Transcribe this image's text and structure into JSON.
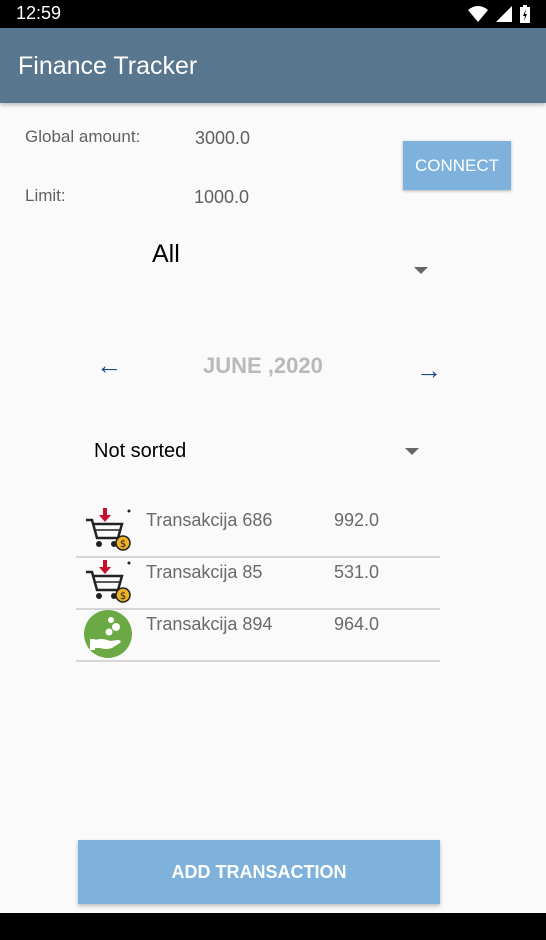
{
  "status": {
    "time": "12:59"
  },
  "app": {
    "title": "Finance Tracker"
  },
  "summary": {
    "global_label": "Global amount:",
    "global_value": "3000.0",
    "limit_label": "Limit:",
    "limit_value": "1000.0",
    "connect_label": "CONNECT"
  },
  "filter": {
    "selected": "All"
  },
  "month_nav": {
    "prev": "←",
    "label": "JUNE ,2020",
    "next": "→"
  },
  "sort": {
    "selected": "Not sorted"
  },
  "transactions": [
    {
      "name": "Transakcija 686",
      "amount": "992.0",
      "icon": "shopping-cart-icon"
    },
    {
      "name": "Transakcija 85",
      "amount": "531.0",
      "icon": "shopping-cart-icon"
    },
    {
      "name": "Transakcija 894",
      "amount": "964.0",
      "icon": "money-hand-icon"
    }
  ],
  "add_button": {
    "label": "ADD TRANSACTION"
  },
  "colors": {
    "app_bar": "#58768d",
    "button": "#7eb2dd",
    "income_icon": "#6aa944"
  }
}
